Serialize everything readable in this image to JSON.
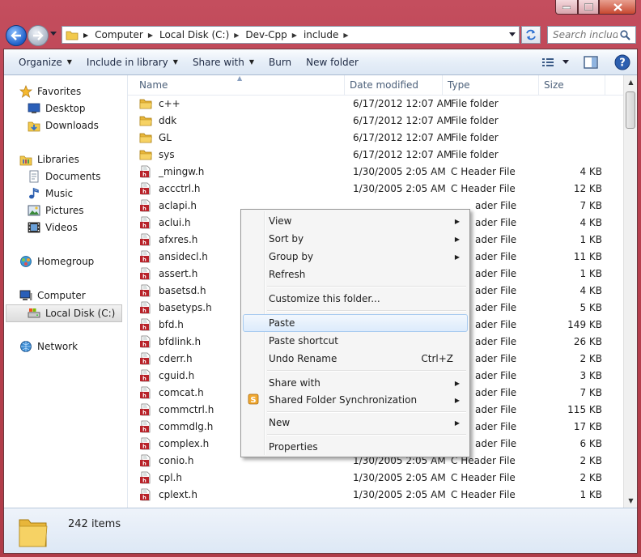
{
  "address": {
    "crumbs": [
      "Computer",
      "Local Disk (C:)",
      "Dev-Cpp",
      "include"
    ]
  },
  "search": {
    "placeholder": "Search include"
  },
  "toolbar": {
    "organize": "Organize",
    "include_in_library": "Include in library",
    "share_with": "Share with",
    "burn": "Burn",
    "new_folder": "New folder"
  },
  "nav": {
    "favorites": "Favorites",
    "desktop": "Desktop",
    "downloads": "Downloads",
    "libraries": "Libraries",
    "documents": "Documents",
    "music": "Music",
    "pictures": "Pictures",
    "videos": "Videos",
    "homegroup": "Homegroup",
    "computer": "Computer",
    "local_disk": "Local Disk (C:)",
    "network": "Network"
  },
  "columns": {
    "name": "Name",
    "date_modified": "Date modified",
    "type": "Type",
    "size": "Size"
  },
  "files": [
    {
      "name": "c++",
      "date": "6/17/2012 12:07 AM",
      "type": "File folder",
      "size": "",
      "kind": "folder"
    },
    {
      "name": "ddk",
      "date": "6/17/2012 12:07 AM",
      "type": "File folder",
      "size": "",
      "kind": "folder"
    },
    {
      "name": "GL",
      "date": "6/17/2012 12:07 AM",
      "type": "File folder",
      "size": "",
      "kind": "folder"
    },
    {
      "name": "sys",
      "date": "6/17/2012 12:07 AM",
      "type": "File folder",
      "size": "",
      "kind": "folder"
    },
    {
      "name": "_mingw.h",
      "date": "1/30/2005 2:05 AM",
      "type": "C Header File",
      "size": "4 KB",
      "kind": "header"
    },
    {
      "name": "accctrl.h",
      "date": "1/30/2005 2:05 AM",
      "type": "C Header File",
      "size": "12 KB",
      "kind": "header"
    },
    {
      "name": "aclapi.h",
      "date": "",
      "type": "ader File",
      "size": "7 KB",
      "kind": "header"
    },
    {
      "name": "aclui.h",
      "date": "",
      "type": "ader File",
      "size": "4 KB",
      "kind": "header"
    },
    {
      "name": "afxres.h",
      "date": "",
      "type": "ader File",
      "size": "1 KB",
      "kind": "header"
    },
    {
      "name": "ansidecl.h",
      "date": "",
      "type": "ader File",
      "size": "11 KB",
      "kind": "header"
    },
    {
      "name": "assert.h",
      "date": "",
      "type": "ader File",
      "size": "1 KB",
      "kind": "header"
    },
    {
      "name": "basetsd.h",
      "date": "",
      "type": "ader File",
      "size": "4 KB",
      "kind": "header"
    },
    {
      "name": "basetyps.h",
      "date": "",
      "type": "ader File",
      "size": "5 KB",
      "kind": "header"
    },
    {
      "name": "bfd.h",
      "date": "",
      "type": "ader File",
      "size": "149 KB",
      "kind": "header"
    },
    {
      "name": "bfdlink.h",
      "date": "",
      "type": "ader File",
      "size": "26 KB",
      "kind": "header"
    },
    {
      "name": "cderr.h",
      "date": "",
      "type": "ader File",
      "size": "2 KB",
      "kind": "header"
    },
    {
      "name": "cguid.h",
      "date": "",
      "type": "ader File",
      "size": "3 KB",
      "kind": "header"
    },
    {
      "name": "comcat.h",
      "date": "",
      "type": "ader File",
      "size": "7 KB",
      "kind": "header"
    },
    {
      "name": "commctrl.h",
      "date": "",
      "type": "ader File",
      "size": "115 KB",
      "kind": "header"
    },
    {
      "name": "commdlg.h",
      "date": "",
      "type": "ader File",
      "size": "17 KB",
      "kind": "header"
    },
    {
      "name": "complex.h",
      "date": "",
      "type": "ader File",
      "size": "6 KB",
      "kind": "header"
    },
    {
      "name": "conio.h",
      "date": "1/30/2005 2:05 AM",
      "type": "C Header File",
      "size": "2 KB",
      "kind": "header"
    },
    {
      "name": "cpl.h",
      "date": "1/30/2005 2:05 AM",
      "type": "C Header File",
      "size": "2 KB",
      "kind": "header"
    },
    {
      "name": "cplext.h",
      "date": "1/30/2005 2:05 AM",
      "type": "C Header File",
      "size": "1 KB",
      "kind": "header"
    }
  ],
  "context_menu": {
    "view": "View",
    "sort_by": "Sort by",
    "group_by": "Group by",
    "refresh": "Refresh",
    "customize": "Customize this folder...",
    "paste": "Paste",
    "paste_shortcut": "Paste shortcut",
    "undo_rename": "Undo Rename",
    "undo_shortcut": "Ctrl+Z",
    "share_with": "Share with",
    "shared_folder_sync": "Shared Folder Synchronization",
    "new": "New",
    "properties": "Properties"
  },
  "status": {
    "item_count": "242 items"
  },
  "colors": {
    "aero_frame": "#b8404f",
    "command_bar": "#dce7f4",
    "folder_yellow": "#f2c94c",
    "header_icon_red": "#b8232a",
    "menu_highlight": "#dcebfc"
  }
}
